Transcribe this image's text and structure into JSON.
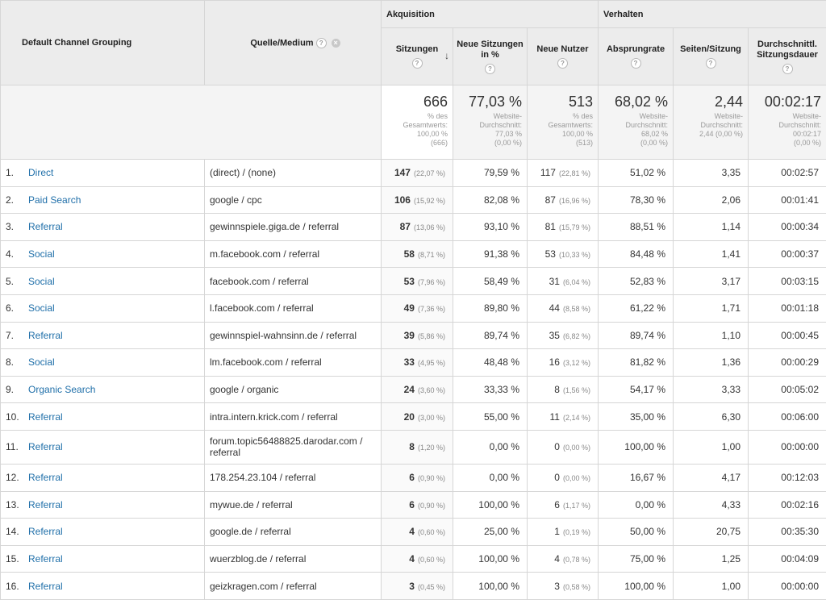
{
  "header": {
    "group_akquisition": "Akquisition",
    "group_verhalten": "Verhalten",
    "col_channel": "Default Channel Grouping",
    "col_source": "Quelle/Medium",
    "col_sessions": "Sitzungen",
    "col_new_sessions": "Neue Sitzungen in %",
    "col_new_users": "Neue Nutzer",
    "col_bounce": "Absprungrate",
    "col_pages": "Seiten/Sitzung",
    "col_duration": "Durchschnittl. Sitzungsdauer"
  },
  "totals": {
    "sessions": {
      "value": "666",
      "note1": "% des",
      "note2": "Gesamtwerts:",
      "note3": "100,00 %",
      "note4": "(666)"
    },
    "new_sessions": {
      "value": "77,03 %",
      "note1": "Website-",
      "note2": "Durchschnitt:",
      "note3": "77,03 %",
      "note4": "(0,00 %)"
    },
    "new_users": {
      "value": "513",
      "note1": "% des",
      "note2": "Gesamtwerts:",
      "note3": "100,00 %",
      "note4": "(513)"
    },
    "bounce": {
      "value": "68,02 %",
      "note1": "Website-",
      "note2": "Durchschnitt:",
      "note3": "68,02 %",
      "note4": "(0,00 %)"
    },
    "pages": {
      "value": "2,44",
      "note1": "Website-",
      "note2": "Durchschnitt:",
      "note3": "2,44 (0,00 %)"
    },
    "duration": {
      "value": "00:02:17",
      "note1": "Website-",
      "note2": "Durchschnitt:",
      "note3": "00:02:17",
      "note4": "(0,00 %)"
    }
  },
  "rows": [
    {
      "idx": "1.",
      "channel": "Direct",
      "source": "(direct) / (none)",
      "sessions": "147",
      "sessions_pct": "(22,07 %)",
      "new_sessions": "79,59 %",
      "new_users": "117",
      "new_users_pct": "(22,81 %)",
      "bounce": "51,02 %",
      "pages": "3,35",
      "duration": "00:02:57"
    },
    {
      "idx": "2.",
      "channel": "Paid Search",
      "source": "google / cpc",
      "sessions": "106",
      "sessions_pct": "(15,92 %)",
      "new_sessions": "82,08 %",
      "new_users": "87",
      "new_users_pct": "(16,96 %)",
      "bounce": "78,30 %",
      "pages": "2,06",
      "duration": "00:01:41"
    },
    {
      "idx": "3.",
      "channel": "Referral",
      "source": "gewinnspiele.giga.de / referral",
      "sessions": "87",
      "sessions_pct": "(13,06 %)",
      "new_sessions": "93,10 %",
      "new_users": "81",
      "new_users_pct": "(15,79 %)",
      "bounce": "88,51 %",
      "pages": "1,14",
      "duration": "00:00:34"
    },
    {
      "idx": "4.",
      "channel": "Social",
      "source": "m.facebook.com / referral",
      "sessions": "58",
      "sessions_pct": "(8,71 %)",
      "new_sessions": "91,38 %",
      "new_users": "53",
      "new_users_pct": "(10,33 %)",
      "bounce": "84,48 %",
      "pages": "1,41",
      "duration": "00:00:37"
    },
    {
      "idx": "5.",
      "channel": "Social",
      "source": "facebook.com / referral",
      "sessions": "53",
      "sessions_pct": "(7,96 %)",
      "new_sessions": "58,49 %",
      "new_users": "31",
      "new_users_pct": "(6,04 %)",
      "bounce": "52,83 %",
      "pages": "3,17",
      "duration": "00:03:15"
    },
    {
      "idx": "6.",
      "channel": "Social",
      "source": "l.facebook.com / referral",
      "sessions": "49",
      "sessions_pct": "(7,36 %)",
      "new_sessions": "89,80 %",
      "new_users": "44",
      "new_users_pct": "(8,58 %)",
      "bounce": "61,22 %",
      "pages": "1,71",
      "duration": "00:01:18"
    },
    {
      "idx": "7.",
      "channel": "Referral",
      "source": "gewinnspiel-wahnsinn.de / referral",
      "sessions": "39",
      "sessions_pct": "(5,86 %)",
      "new_sessions": "89,74 %",
      "new_users": "35",
      "new_users_pct": "(6,82 %)",
      "bounce": "89,74 %",
      "pages": "1,10",
      "duration": "00:00:45"
    },
    {
      "idx": "8.",
      "channel": "Social",
      "source": "lm.facebook.com / referral",
      "sessions": "33",
      "sessions_pct": "(4,95 %)",
      "new_sessions": "48,48 %",
      "new_users": "16",
      "new_users_pct": "(3,12 %)",
      "bounce": "81,82 %",
      "pages": "1,36",
      "duration": "00:00:29"
    },
    {
      "idx": "9.",
      "channel": "Organic Search",
      "source": "google / organic",
      "sessions": "24",
      "sessions_pct": "(3,60 %)",
      "new_sessions": "33,33 %",
      "new_users": "8",
      "new_users_pct": "(1,56 %)",
      "bounce": "54,17 %",
      "pages": "3,33",
      "duration": "00:05:02"
    },
    {
      "idx": "10.",
      "channel": "Referral",
      "source": "intra.intern.krick.com / referral",
      "sessions": "20",
      "sessions_pct": "(3,00 %)",
      "new_sessions": "55,00 %",
      "new_users": "11",
      "new_users_pct": "(2,14 %)",
      "bounce": "35,00 %",
      "pages": "6,30",
      "duration": "00:06:00"
    },
    {
      "idx": "11.",
      "channel": "Referral",
      "source": "forum.topic56488825.darodar.com / referral",
      "sessions": "8",
      "sessions_pct": "(1,20 %)",
      "new_sessions": "0,00 %",
      "new_users": "0",
      "new_users_pct": "(0,00 %)",
      "bounce": "100,00 %",
      "pages": "1,00",
      "duration": "00:00:00"
    },
    {
      "idx": "12.",
      "channel": "Referral",
      "source": "178.254.23.104 / referral",
      "sessions": "6",
      "sessions_pct": "(0,90 %)",
      "new_sessions": "0,00 %",
      "new_users": "0",
      "new_users_pct": "(0,00 %)",
      "bounce": "16,67 %",
      "pages": "4,17",
      "duration": "00:12:03"
    },
    {
      "idx": "13.",
      "channel": "Referral",
      "source": "mywue.de / referral",
      "sessions": "6",
      "sessions_pct": "(0,90 %)",
      "new_sessions": "100,00 %",
      "new_users": "6",
      "new_users_pct": "(1,17 %)",
      "bounce": "0,00 %",
      "pages": "4,33",
      "duration": "00:02:16"
    },
    {
      "idx": "14.",
      "channel": "Referral",
      "source": "google.de / referral",
      "sessions": "4",
      "sessions_pct": "(0,60 %)",
      "new_sessions": "25,00 %",
      "new_users": "1",
      "new_users_pct": "(0,19 %)",
      "bounce": "50,00 %",
      "pages": "20,75",
      "duration": "00:35:30"
    },
    {
      "idx": "15.",
      "channel": "Referral",
      "source": "wuerzblog.de / referral",
      "sessions": "4",
      "sessions_pct": "(0,60 %)",
      "new_sessions": "100,00 %",
      "new_users": "4",
      "new_users_pct": "(0,78 %)",
      "bounce": "75,00 %",
      "pages": "1,25",
      "duration": "00:04:09"
    },
    {
      "idx": "16.",
      "channel": "Referral",
      "source": "geizkragen.com / referral",
      "sessions": "3",
      "sessions_pct": "(0,45 %)",
      "new_sessions": "100,00 %",
      "new_users": "3",
      "new_users_pct": "(0,58 %)",
      "bounce": "100,00 %",
      "pages": "1,00",
      "duration": "00:00:00"
    }
  ],
  "icons": {
    "help": "question-icon",
    "remove": "close-icon",
    "sort": "sort-down-arrow-icon"
  },
  "colors": {
    "link": "#1f6fa9",
    "header_bg": "#ececec"
  }
}
